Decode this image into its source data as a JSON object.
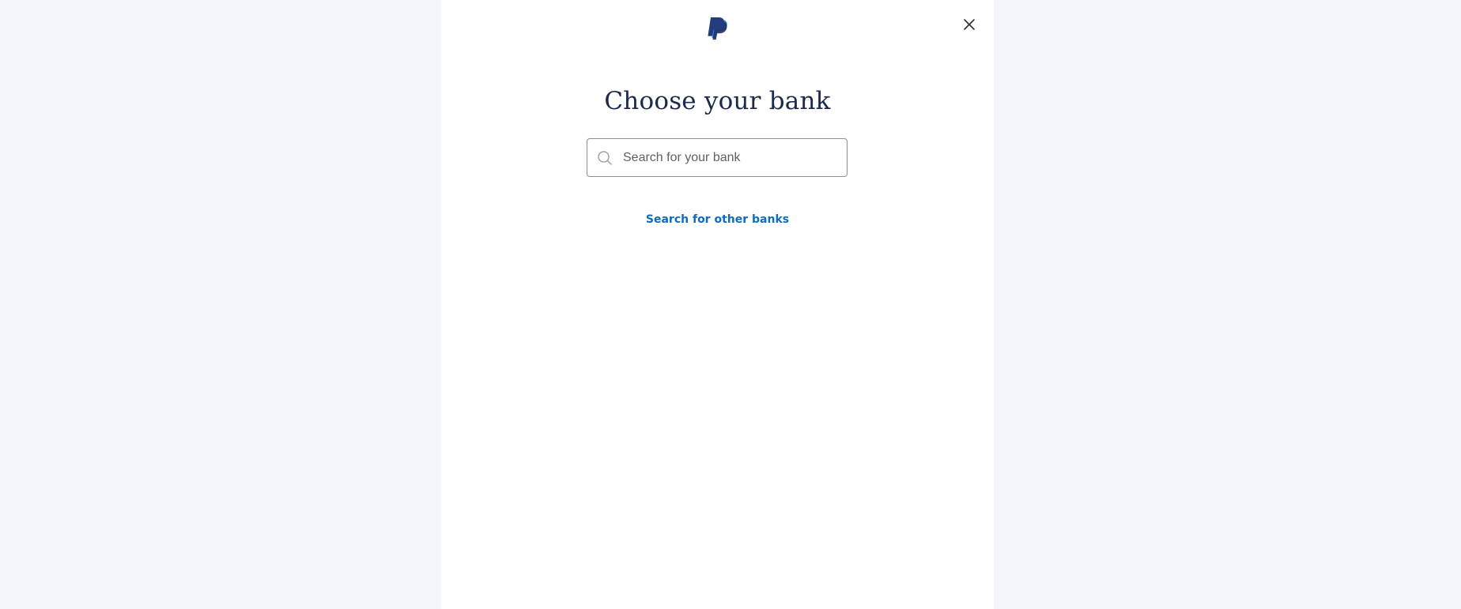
{
  "header": {
    "logo_icon": "paypal-logo-icon",
    "close_icon": "close-icon"
  },
  "main": {
    "title": "Choose your bank",
    "search": {
      "placeholder": "Search for your bank",
      "value": "",
      "icon": "search-icon"
    },
    "other_banks_link": "Search for other banks"
  },
  "colors": {
    "background": "#f4f5fa",
    "panel": "#ffffff",
    "title_text": "#1b2a4a",
    "link": "#0f6cbd",
    "logo_dark": "#253b80",
    "logo_light": "#179bd7"
  }
}
